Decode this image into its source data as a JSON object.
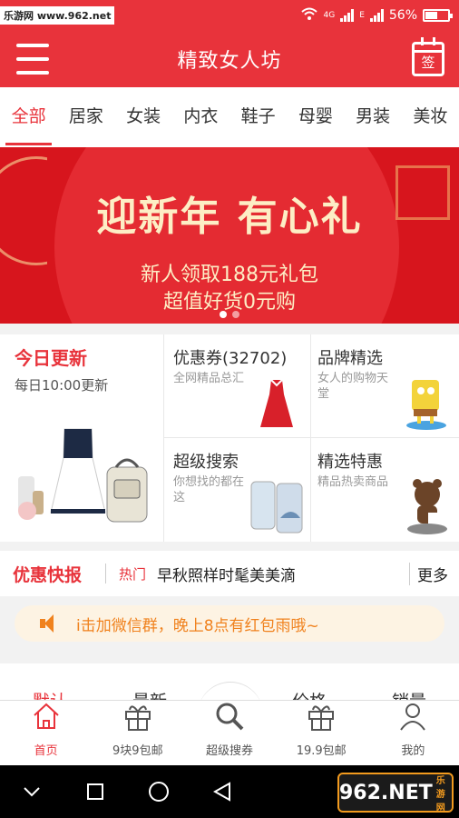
{
  "status_bar": {
    "watermark": "乐游网 www.962.net",
    "network": "4G",
    "network2": "E",
    "battery": "56%"
  },
  "header": {
    "title": "精致女人坊",
    "sign_label": "签"
  },
  "categories": [
    "全部",
    "居家",
    "女装",
    "内衣",
    "鞋子",
    "母婴",
    "男装",
    "美妆"
  ],
  "banner": {
    "headline": "迎新年 有心礼",
    "line1": "新人领取188元礼包",
    "line2": "超值好货0元购"
  },
  "today": {
    "title": "今日更新",
    "subtitle": "每日10:00更新"
  },
  "cells": [
    {
      "title": "优惠券(32702)",
      "subtitle": "全网精品总汇"
    },
    {
      "title": "品牌精选",
      "subtitle": "女人的购物天堂"
    },
    {
      "title": "超级搜索",
      "subtitle": "你想找的都在这"
    },
    {
      "title": "精选特惠",
      "subtitle": "精品热卖商品"
    }
  ],
  "promo": {
    "title": "优惠快报",
    "tag": "热门",
    "text": "早秋照样时髦美美滴",
    "more": "更多"
  },
  "notice": {
    "text": "i击加微信群，晚上8点有红包雨哦~"
  },
  "sort": [
    "默认",
    "最新",
    "价格",
    "销量"
  ],
  "tabbar": [
    {
      "label": "首页",
      "icon": "home-icon"
    },
    {
      "label": "9块9包邮",
      "icon": "gift-icon"
    },
    {
      "label": "超级搜券",
      "icon": "search-icon"
    },
    {
      "label": "19.9包邮",
      "icon": "gift-icon"
    },
    {
      "label": "我的",
      "icon": "user-icon"
    }
  ],
  "nav_logo": {
    "text": "962.NET",
    "sub": "乐游网"
  },
  "colors": {
    "brand": "#e8333b",
    "notice": "#f0821e"
  }
}
